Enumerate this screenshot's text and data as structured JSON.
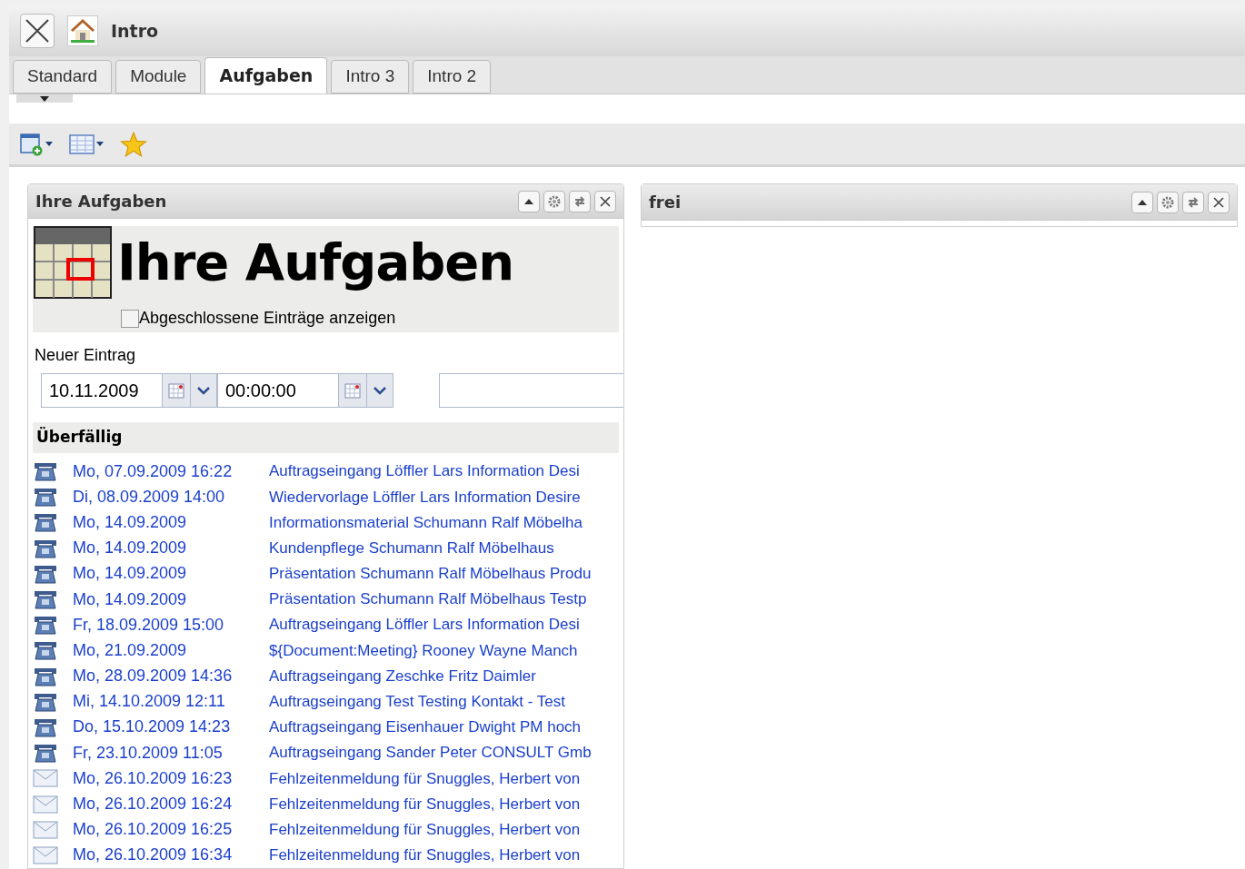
{
  "window": {
    "title": "Intro"
  },
  "tabs": [
    {
      "label": "Standard",
      "selected": false
    },
    {
      "label": "Module",
      "selected": false
    },
    {
      "label": "Aufgaben",
      "selected": true
    },
    {
      "label": "Intro 3",
      "selected": false
    },
    {
      "label": "Intro 2",
      "selected": false
    }
  ],
  "panels": [
    {
      "title": "Ihre Aufgaben",
      "heading": "Ihre Aufgaben",
      "show_completed": {
        "label": "Abgeschlossene Einträge anzeigen",
        "checked": false
      },
      "new_entry": {
        "label": "Neuer Eintrag",
        "date": "10.11.2009",
        "time": "00:00:00"
      },
      "section": "Überfällig",
      "rows": [
        {
          "kind": "task",
          "date": "Mo, 07.09.2009 16:22",
          "title": "Auftragseingang Löffler Lars Information Desi"
        },
        {
          "kind": "task",
          "date": "Di, 08.09.2009 14:00",
          "title": "Wiedervorlage Löffler Lars Information Desire"
        },
        {
          "kind": "task",
          "date": "Mo, 14.09.2009",
          "title": "Informationsmaterial Schumann Ralf Möbelha"
        },
        {
          "kind": "task",
          "date": "Mo, 14.09.2009",
          "title": "Kundenpflege Schumann Ralf Möbelhaus"
        },
        {
          "kind": "task",
          "date": "Mo, 14.09.2009",
          "title": "Präsentation Schumann Ralf Möbelhaus Produ"
        },
        {
          "kind": "task",
          "date": "Mo, 14.09.2009",
          "title": "Präsentation Schumann Ralf Möbelhaus Testp"
        },
        {
          "kind": "task",
          "date": "Fr, 18.09.2009 15:00",
          "title": "Auftragseingang Löffler Lars Information Desi"
        },
        {
          "kind": "task",
          "date": "Mo, 21.09.2009",
          "title": "${Document:Meeting} Rooney Wayne Manch"
        },
        {
          "kind": "task",
          "date": "Mo, 28.09.2009 14:36",
          "title": "Auftragseingang Zeschke Fritz Daimler"
        },
        {
          "kind": "task",
          "date": "Mi, 14.10.2009 12:11",
          "title": "Auftragseingang Test Testing Kontakt - Test"
        },
        {
          "kind": "task",
          "date": "Do, 15.10.2009 14:23",
          "title": "Auftragseingang Eisenhauer Dwight PM hoch"
        },
        {
          "kind": "task",
          "date": "Fr, 23.10.2009 11:05",
          "title": "Auftragseingang Sander Peter CONSULT Gmb"
        },
        {
          "kind": "mail",
          "date": "Mo, 26.10.2009 16:23",
          "title": "Fehlzeitenmeldung für Snuggles, Herbert von"
        },
        {
          "kind": "mail",
          "date": "Mo, 26.10.2009 16:24",
          "title": "Fehlzeitenmeldung für Snuggles, Herbert von"
        },
        {
          "kind": "mail",
          "date": "Mo, 26.10.2009 16:25",
          "title": "Fehlzeitenmeldung für Snuggles, Herbert von"
        },
        {
          "kind": "mail",
          "date": "Mo, 26.10.2009 16:34",
          "title": "Fehlzeitenmeldung für Snuggles, Herbert von"
        }
      ]
    },
    {
      "title": "frei"
    }
  ]
}
